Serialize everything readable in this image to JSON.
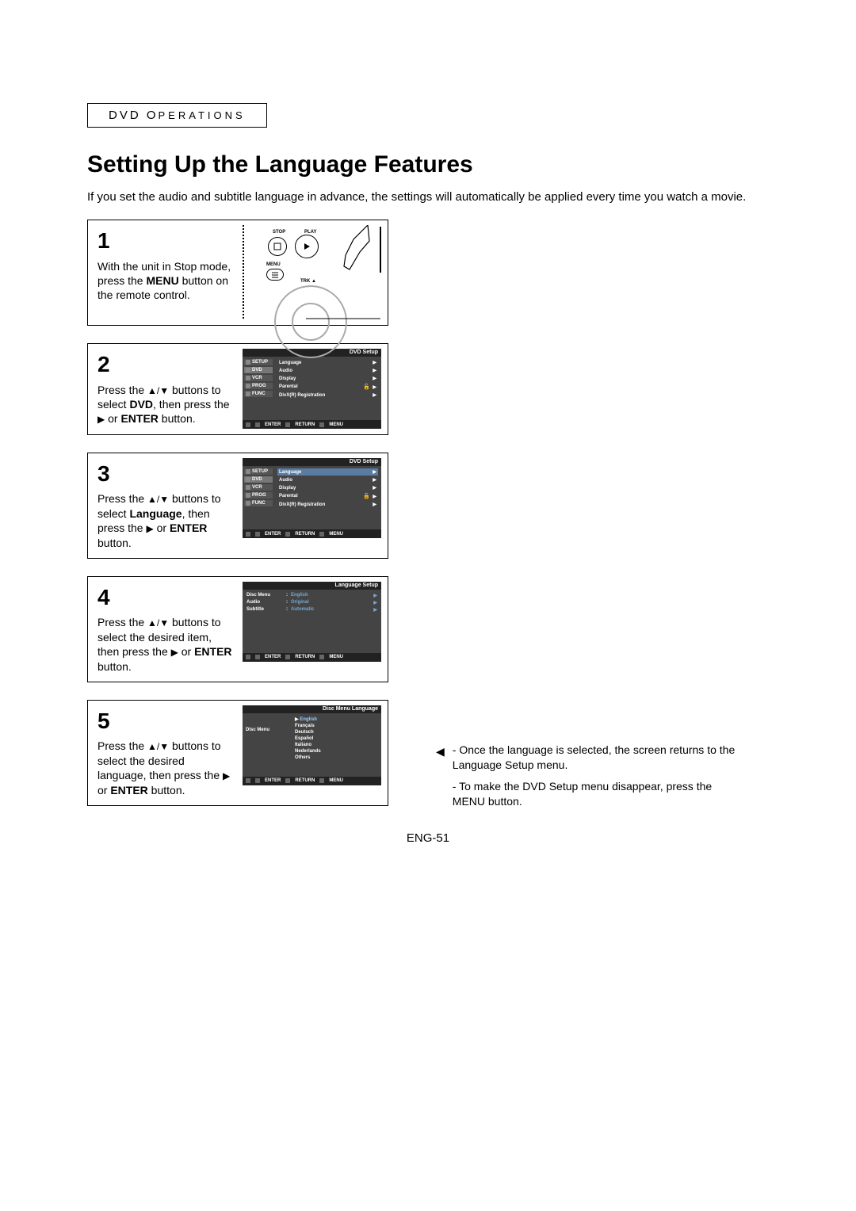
{
  "section_header": {
    "prefix": "DVD O",
    "suffix": "PERATIONS"
  },
  "title": "Setting Up the Language Features",
  "intro": "If you set the audio and subtitle language in advance, the settings will automatically be applied every time you watch a movie.",
  "steps": {
    "s1": {
      "num": "1",
      "t1": "With the unit in Stop mode, press the ",
      "t2": "MENU",
      "t3": " button on the remote control."
    },
    "s2": {
      "num": "2",
      "t1": "Press the ",
      "t2": " buttons to select ",
      "t3": "DVD",
      "t4": ", then press the ",
      "t5": " or ",
      "t6": "ENTER",
      "t7": " button."
    },
    "s3": {
      "num": "3",
      "t1": "Press the ",
      "t2": " buttons to select ",
      "t3": "Language",
      "t4": ", then press the ",
      "t5": " or ",
      "t6": "ENTER",
      "t7": " button."
    },
    "s4": {
      "num": "4",
      "t1": "Press the ",
      "t2": " buttons to select the desired item, then press the ",
      "t3": " or ",
      "t4": "ENTER",
      "t5": " button."
    },
    "s5": {
      "num": "5",
      "t1": "Press the ",
      "t2": " buttons to select the desired language, then press the ",
      "t3": " or ",
      "t4": "ENTER",
      "t5": " button."
    }
  },
  "remote": {
    "stop": "STOP",
    "play": "PLAY",
    "menu": "MENU",
    "trk": "TRK ▲"
  },
  "side_menu": {
    "setup": "SETUP",
    "dvd": "DVD",
    "vcr": "VCR",
    "prog": "PROG",
    "func": "FUNC"
  },
  "dvd_setup": {
    "header": "DVD Setup",
    "items": {
      "language": "Language",
      "audio": "Audio",
      "display": "Display",
      "parental": "Parental",
      "divx": "DivX(R) Registration"
    }
  },
  "lang_setup": {
    "header": "Language Setup",
    "discmenu": "Disc Menu",
    "audio": "Audio",
    "subtitle": "Subtitle",
    "v_english": "English",
    "v_original": "Original",
    "v_automatic": "Automatic"
  },
  "discmenu_lang": {
    "header": "Disc Menu Language",
    "side": "Disc Menu",
    "english": "English",
    "francais": "Français",
    "deutsch": "Deutsch",
    "espanol": "Español",
    "italiano": "Italiano",
    "nederlands": "Nederlands",
    "others": "Others"
  },
  "footer": {
    "enter": "ENTER",
    "return": "RETURN",
    "menu": "MENU"
  },
  "notes": {
    "n1": "Once the language is selected, the screen returns to the Language Setup menu.",
    "n2": "To make the DVD Setup menu disappear, press the MENU button."
  },
  "pagenum": "ENG-51",
  "glyph": {
    "updown": "▲/▼",
    "right": "▶"
  }
}
